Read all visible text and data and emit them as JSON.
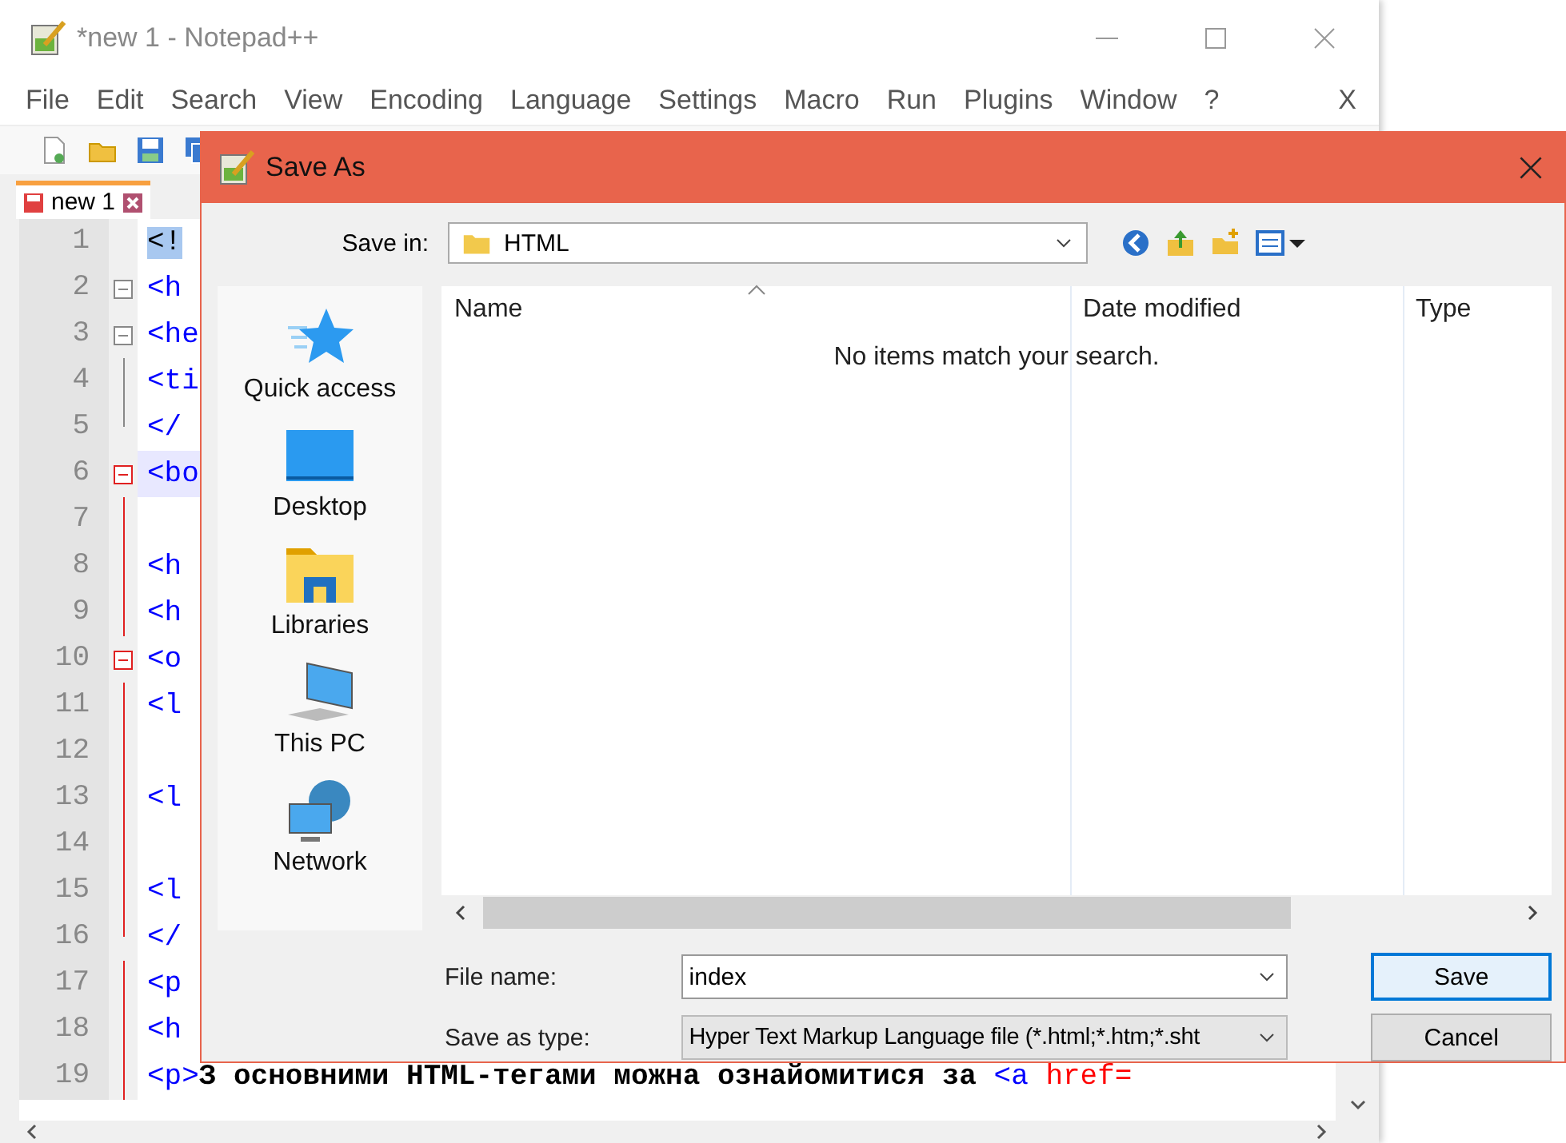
{
  "editor_window": {
    "title": "*new  1 - Notepad++",
    "menu": [
      "File",
      "Edit",
      "Search",
      "View",
      "Encoding",
      "Language",
      "Settings",
      "Macro",
      "Run",
      "Plugins",
      "Window",
      "?"
    ],
    "menu_close": "X",
    "tabs": [
      {
        "label": "new 1",
        "selected": true
      }
    ],
    "lines": [
      {
        "number": "1",
        "kind": "plain",
        "current": false,
        "tokens": [
          {
            "kind": "selected",
            "text": "<!"
          }
        ]
      },
      {
        "number": "2",
        "kind": "open",
        "current": false,
        "tokens": [
          {
            "kind": "tag",
            "text": "<h"
          }
        ]
      },
      {
        "number": "3",
        "kind": "open",
        "current": false,
        "tokens": [
          {
            "kind": "tag",
            "text": "<he"
          }
        ]
      },
      {
        "number": "4",
        "kind": "line",
        "current": false,
        "tokens": [
          {
            "kind": "tag",
            "text": "<ti"
          }
        ]
      },
      {
        "number": "5",
        "kind": "end",
        "current": false,
        "tokens": [
          {
            "kind": "tag",
            "text": "</"
          }
        ]
      },
      {
        "number": "6",
        "kind": "open",
        "current": true,
        "tokens": [
          {
            "kind": "tag",
            "text": "<bo"
          }
        ]
      },
      {
        "number": "7",
        "kind": "line",
        "current": false
      },
      {
        "number": "8",
        "kind": "line",
        "current": false,
        "tokens": [
          {
            "kind": "tag",
            "text": "<h"
          }
        ]
      },
      {
        "number": "9",
        "kind": "line",
        "current": false,
        "tokens": [
          {
            "kind": "tag",
            "text": "<h"
          }
        ]
      },
      {
        "number": "10",
        "kind": "open",
        "current": false,
        "tokens": [
          {
            "kind": "tag",
            "text": "<o"
          }
        ]
      },
      {
        "number": "11",
        "kind": "line",
        "current": false,
        "tokens": [
          {
            "kind": "tag",
            "text": "<l"
          }
        ]
      },
      {
        "number": "12",
        "kind": "line",
        "current": false
      },
      {
        "number": "13",
        "kind": "line",
        "current": false,
        "tokens": [
          {
            "kind": "tag",
            "text": "<l"
          }
        ]
      },
      {
        "number": "14",
        "kind": "line",
        "current": false
      },
      {
        "number": "15",
        "kind": "line",
        "current": false,
        "tokens": [
          {
            "kind": "tag",
            "text": "<l"
          }
        ]
      },
      {
        "number": "16",
        "kind": "end",
        "current": false,
        "tokens": [
          {
            "kind": "tag",
            "text": "</"
          }
        ]
      },
      {
        "number": "17",
        "kind": "line",
        "current": false,
        "tokens": [
          {
            "kind": "tag",
            "text": "<p"
          }
        ]
      },
      {
        "number": "18",
        "kind": "line",
        "current": false,
        "tokens": [
          {
            "kind": "tag",
            "text": "<h"
          }
        ]
      },
      {
        "number": "19",
        "kind": "line",
        "current": false,
        "tokens": [
          {
            "kind": "tag",
            "text": "<p>"
          },
          {
            "kind": "text",
            "text": "З основними HTML-тегами можна ознайомитися за "
          },
          {
            "kind": "tag",
            "text": "<a "
          },
          {
            "kind": "attr",
            "text": "href="
          }
        ]
      }
    ]
  },
  "dialog": {
    "title": "Save As",
    "save_in": {
      "label": "Save in:",
      "value": "HTML"
    },
    "places": [
      {
        "kind": "star",
        "label": "Quick access"
      },
      {
        "kind": "desktop",
        "label": "Desktop"
      },
      {
        "kind": "library",
        "label": "Libraries"
      },
      {
        "kind": "pc",
        "label": "This PC"
      },
      {
        "kind": "network",
        "label": "Network"
      }
    ],
    "columns": [
      {
        "label": "Name",
        "sorted": true
      },
      {
        "label": "Date modified",
        "sorted": false
      },
      {
        "label": "Type",
        "sorted": false
      }
    ],
    "empty_message": "No items match your search.",
    "file_name": {
      "label": "File name:",
      "value": "index"
    },
    "save_type": {
      "label": "Save as type:",
      "value": "Hyper Text Markup Language file (*.html;*.htm;*.sht"
    },
    "buttons": [
      {
        "label": "Save",
        "default": true
      },
      {
        "label": "Cancel",
        "default": false
      }
    ]
  }
}
